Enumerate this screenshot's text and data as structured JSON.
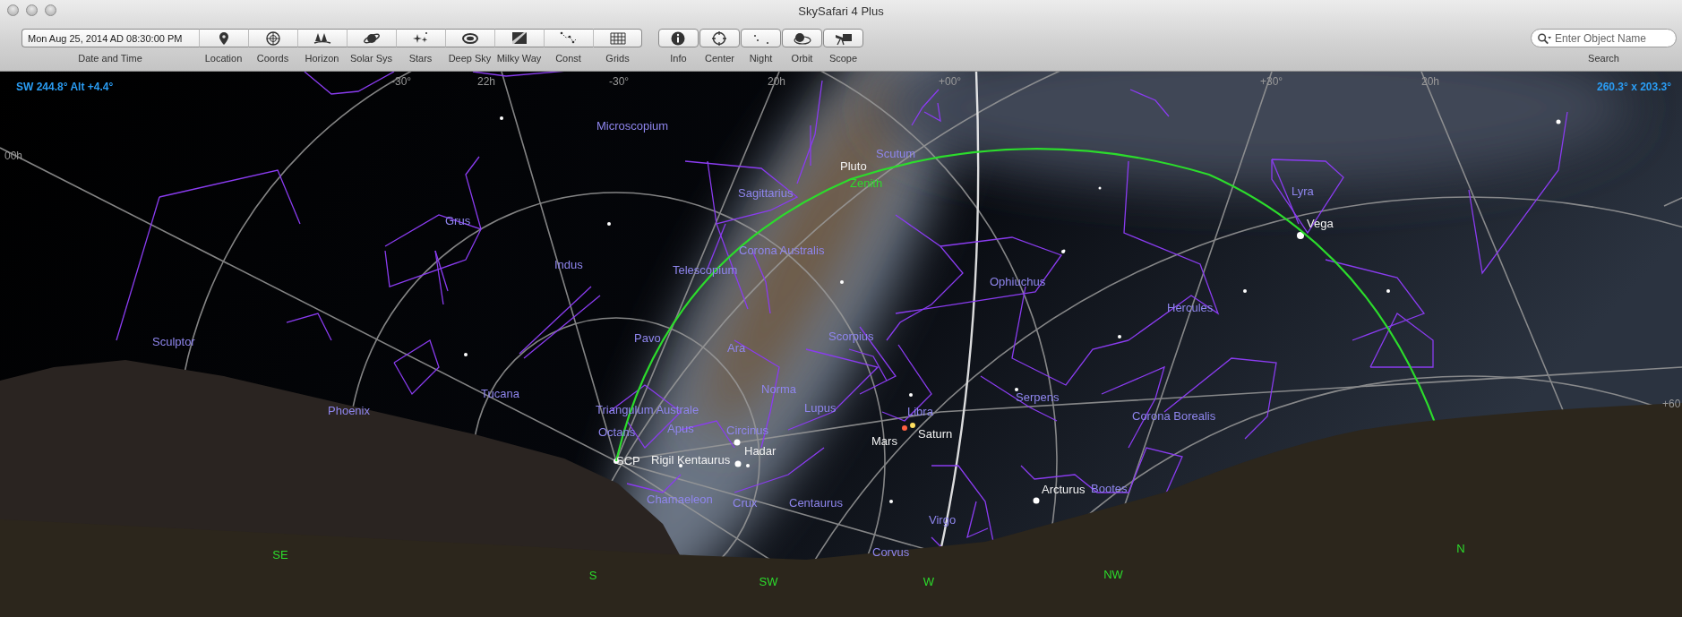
{
  "window": {
    "title": "SkySafari 4 Plus"
  },
  "toolbar": {
    "date_time": {
      "value": "Mon Aug 25, 2014 AD 08:30:00 PM",
      "label": "Date and Time"
    },
    "view_buttons": [
      {
        "label": "Location"
      },
      {
        "label": "Coords"
      },
      {
        "label": "Horizon"
      },
      {
        "label": "Solar Sys"
      },
      {
        "label": "Stars"
      },
      {
        "label": "Deep Sky"
      },
      {
        "label": "Milky Way"
      },
      {
        "label": "Const"
      },
      {
        "label": "Grids"
      }
    ],
    "tool_buttons": [
      {
        "label": "Info"
      },
      {
        "label": "Center"
      },
      {
        "label": "Night"
      },
      {
        "label": "Orbit"
      },
      {
        "label": "Scope"
      }
    ],
    "search": {
      "placeholder": "Enter Object Name",
      "label": "Search"
    }
  },
  "sky_view": {
    "view_direction": "SW 244.8° Alt +4.4°",
    "field_of_view": "260.3° x 203.3°",
    "grid_labels": [
      "-30°",
      "22h",
      "-30°",
      "20h",
      "+00°",
      "+30°",
      "20h",
      "00h",
      "+60"
    ],
    "constellations": [
      "Microscopium",
      "Sagittarius",
      "Scutum",
      "Grus",
      "Indus",
      "Corona Australis",
      "Telescopium",
      "Lyra",
      "Ophiuchus",
      "Hercules",
      "Sculptor",
      "Pavo",
      "Ara",
      "Scorpius",
      "Norma",
      "Tucana",
      "Phoenix",
      "Triangulum Australe",
      "Lupus",
      "Serpens",
      "Libra",
      "Corona Borealis",
      "Octans",
      "Apus",
      "Circinus",
      "Centaurus",
      "Chamaeleon",
      "Crux",
      "Virgo",
      "Bootes",
      "Corvus"
    ],
    "objects": [
      {
        "name": "Pluto",
        "kind": "planet"
      },
      {
        "name": "Zenith",
        "kind": "reference"
      },
      {
        "name": "Vega",
        "kind": "star"
      },
      {
        "name": "Hadar",
        "kind": "star"
      },
      {
        "name": "SCP",
        "kind": "pole"
      },
      {
        "name": "Rigil Kentaurus",
        "kind": "star"
      },
      {
        "name": "Mars",
        "kind": "planet"
      },
      {
        "name": "Saturn",
        "kind": "planet"
      },
      {
        "name": "Arcturus",
        "kind": "star"
      }
    ],
    "compass_points": [
      "SE",
      "S",
      "SW",
      "W",
      "NW",
      "N"
    ]
  }
}
